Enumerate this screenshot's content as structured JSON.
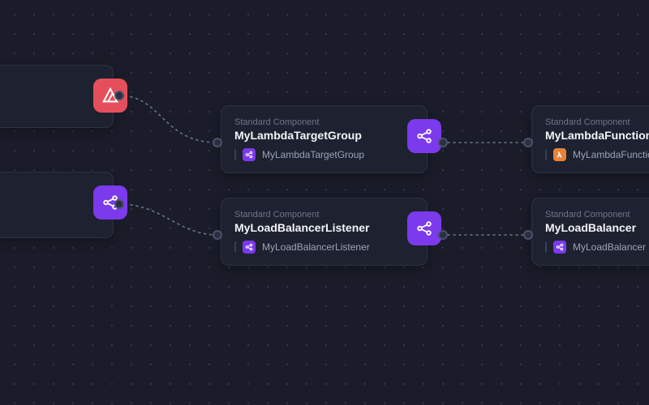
{
  "category_label": "Standard Component",
  "nodes": {
    "lambdaTargetGroup": {
      "category": "Standard Component",
      "title": "MyLambdaTargetGroup",
      "sub_label": "MyLambdaTargetGroup",
      "icon": "share-icon",
      "icon_color": "purple",
      "sub_icon_color": "purple"
    },
    "loadBalancerListener": {
      "category": "Standard Component",
      "title": "MyLoadBalancerListener",
      "sub_label": "MyLoadBalancerListener",
      "icon": "share-icon",
      "icon_color": "purple",
      "sub_icon_color": "purple"
    },
    "lambdaFunction": {
      "category": "Standard Component",
      "title": "MyLambdaFunction",
      "sub_label": "MyLambdaFunction",
      "icon": "lambda-icon",
      "sub_icon_color": "orange"
    },
    "loadBalancer": {
      "category": "Standard Component",
      "title": "MyLoadBalancer",
      "sub_label": "MyLoadBalancer",
      "icon": "share-icon",
      "sub_icon_color": "purple"
    },
    "partialTop": {
      "icon": "triangle-icon",
      "icon_color": "red"
    },
    "partialBottom": {
      "icon": "share-icon",
      "icon_color": "purple"
    }
  },
  "colors": {
    "bg": "#1a1d29",
    "node_bg": "#1e2230",
    "border": "#2d3244",
    "purple": "#7c3aed",
    "red": "#e54f5b",
    "orange": "#e8833a"
  }
}
